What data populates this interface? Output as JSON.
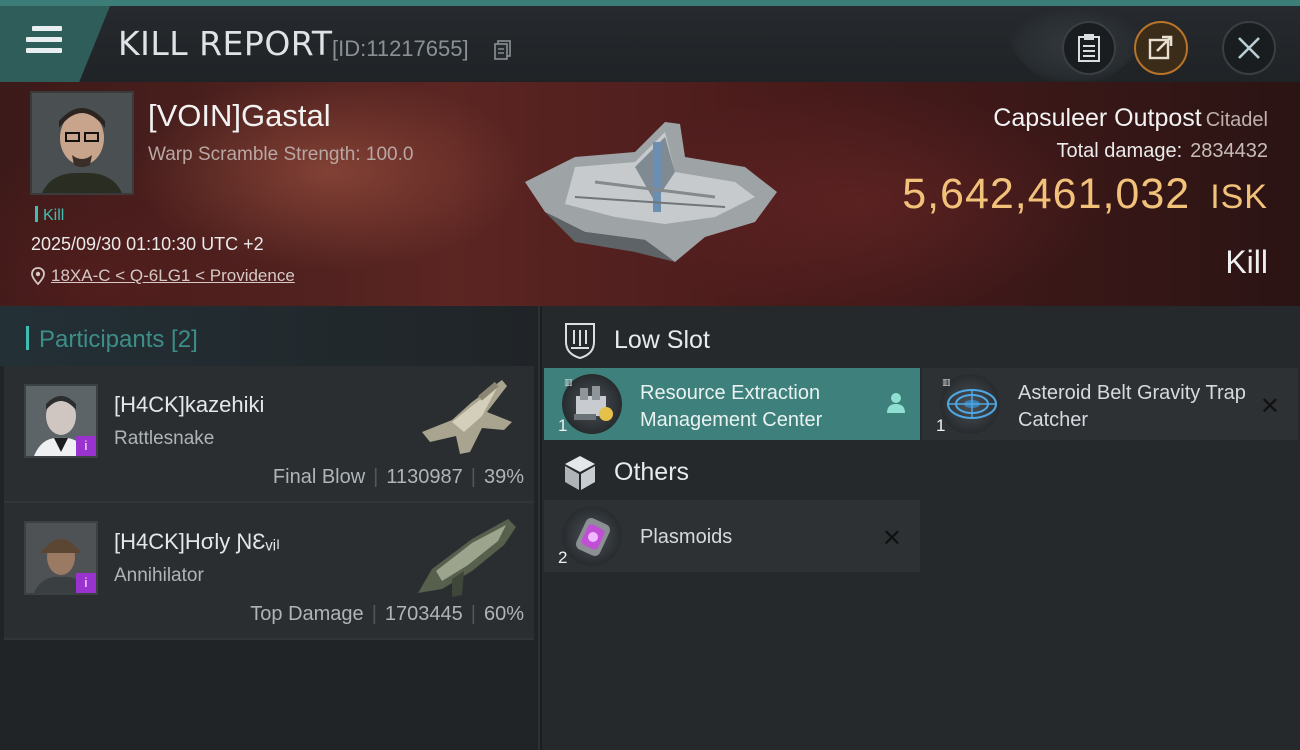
{
  "topbar": {
    "title": "KILL REPORT",
    "report_id": "[ID:11217655]",
    "buttons": {
      "clipboard": "clipboard-icon",
      "share": "share-icon",
      "close": "close-icon"
    },
    "accent_color": "#3c7d78"
  },
  "victim": {
    "name": "[VOIN]Gastal",
    "scramble": "Warp Scramble Strength: 100.0",
    "tag": "Kill",
    "datetime": "2025/09/30 01:10:30 UTC +2",
    "location": "18XA-C < Q-6LG1 < Providence"
  },
  "summary": {
    "ship_name": "Capsuleer Outpost",
    "ship_class": "Citadel",
    "total_damage_label": "Total damage:",
    "total_damage_value": "2834432",
    "isk_value": "5,642,461,032",
    "isk_unit": "ISK",
    "result": "Kill",
    "isk_color": "#f2c27a"
  },
  "participants": {
    "header": "Participants [2]",
    "list": [
      {
        "name": "[H4CK]kazehiki",
        "ship": "Rattlesnake",
        "role": "Final Blow",
        "damage": "1130987",
        "percent": "39%",
        "badge": "i"
      },
      {
        "name": "[H4CK]Hσly ƝƐᵥᵢₗ",
        "ship": "Annihilator",
        "role": "Top Damage",
        "damage": "1703445",
        "percent": "60%",
        "badge": "i"
      }
    ]
  },
  "items": {
    "low_slot_label": "Low Slot",
    "others_label": "Others",
    "low_slot": [
      {
        "name": "Resource Extraction Management Center",
        "qty": "1",
        "status": "dropped",
        "status_icon": "person-icon"
      },
      {
        "name": "Asteroid Belt Gravity Trap Catcher",
        "qty": "1",
        "status": "destroyed",
        "status_icon": "x-mark"
      }
    ],
    "others": [
      {
        "name": "Plasmoids",
        "qty": "2",
        "status": "destroyed",
        "status_icon": "x-mark"
      }
    ],
    "x_mark": "✕"
  }
}
